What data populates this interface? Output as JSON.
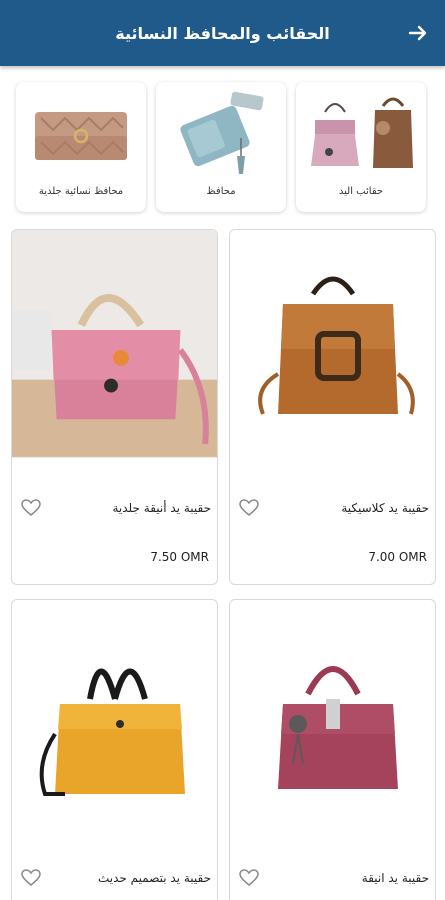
{
  "header": {
    "title": "الحقائب والمحافظ النسائية",
    "back_icon": "arrow-right-icon",
    "color": "#1f5a8a"
  },
  "categories": [
    {
      "label": "حقائب اليد",
      "icon": "handbags-image"
    },
    {
      "label": "محافظ",
      "icon": "wallet-image"
    },
    {
      "label": "محافظ نسائية جلدية",
      "icon": "leather-wallet-image"
    }
  ],
  "products": [
    {
      "name": "حقيبة يد كلاسيكية",
      "price": "7.00 OMR"
    },
    {
      "name": "حقيبة يد أنيقة جلدية",
      "price": "7.50 OMR"
    },
    {
      "name": "حقيبة يد انيقة",
      "price": ""
    },
    {
      "name": "حقيبة يد بتصميم حديث",
      "price": ""
    }
  ]
}
